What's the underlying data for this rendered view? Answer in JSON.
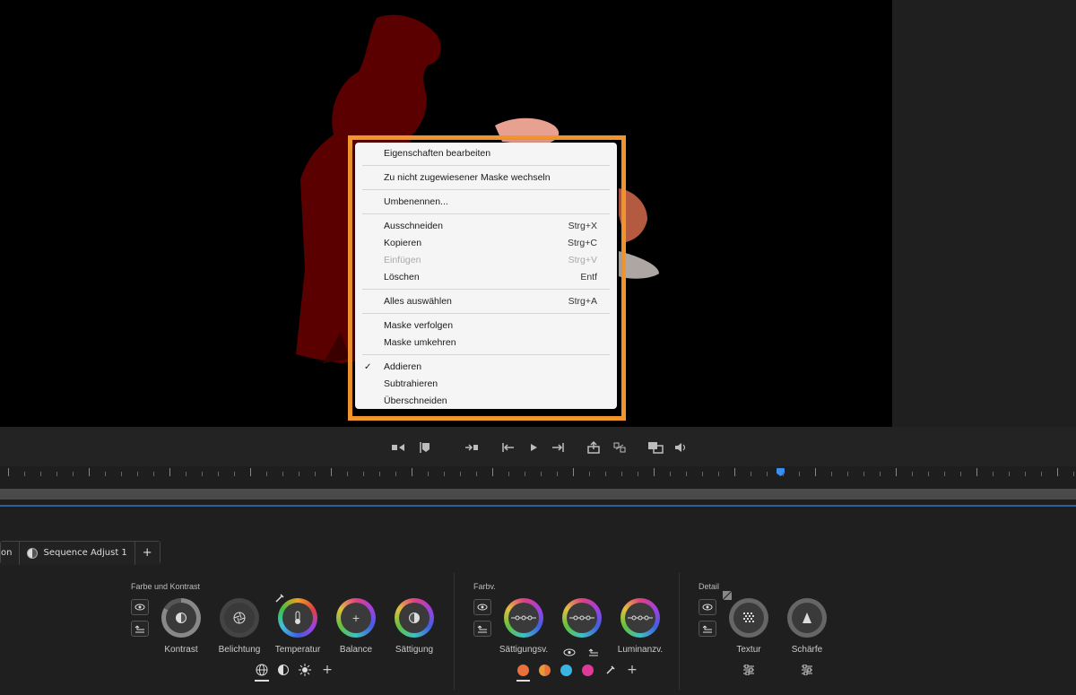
{
  "context_menu": {
    "items": [
      {
        "label": "Eigenschaften bearbeiten",
        "shortcut": ""
      },
      {
        "label": "Zu nicht zugewiesener Maske wechseln",
        "shortcut": ""
      },
      {
        "label": "Umbenennen...",
        "shortcut": ""
      },
      {
        "label": "Ausschneiden",
        "shortcut": "Strg+X"
      },
      {
        "label": "Kopieren",
        "shortcut": "Strg+C"
      },
      {
        "label": "Einfügen",
        "shortcut": "Strg+V"
      },
      {
        "label": "Löschen",
        "shortcut": "Entf"
      },
      {
        "label": "Alles auswählen",
        "shortcut": "Strg+A"
      },
      {
        "label": "Maske verfolgen",
        "shortcut": ""
      },
      {
        "label": "Maske umkehren",
        "shortcut": ""
      },
      {
        "label": "Addieren",
        "shortcut": ""
      },
      {
        "label": "Subtrahieren",
        "shortcut": ""
      },
      {
        "label": "Überschneiden",
        "shortcut": ""
      }
    ],
    "check_mark": "✓"
  },
  "tabs": {
    "partial_label": "on",
    "sequence_label": "Sequence Adjust 1",
    "add_label": "+"
  },
  "sections": {
    "farbe_kontrast": {
      "title": "Farbe und Kontrast",
      "dials": [
        "Kontrast",
        "Belichtung",
        "Temperatur",
        "Balance",
        "Sättigung"
      ],
      "balance_symbol": "+",
      "add_label": "+"
    },
    "farbv": {
      "title": "Farbv.",
      "dials": [
        "Sättigungsv.",
        "Luminanzv."
      ],
      "add_label": "+"
    },
    "detail": {
      "title": "Detail",
      "dials": [
        "Textur",
        "Schärfe"
      ]
    }
  },
  "colors": {
    "highlight": "#f2952c",
    "playhead": "#3a8ef0",
    "mask_red": "#5a0000",
    "dot_orange": "#e8703a",
    "dot_half_orange": "#e89a3a",
    "dot_cyan": "#3ab4e0",
    "dot_magenta": "#e0399a"
  }
}
